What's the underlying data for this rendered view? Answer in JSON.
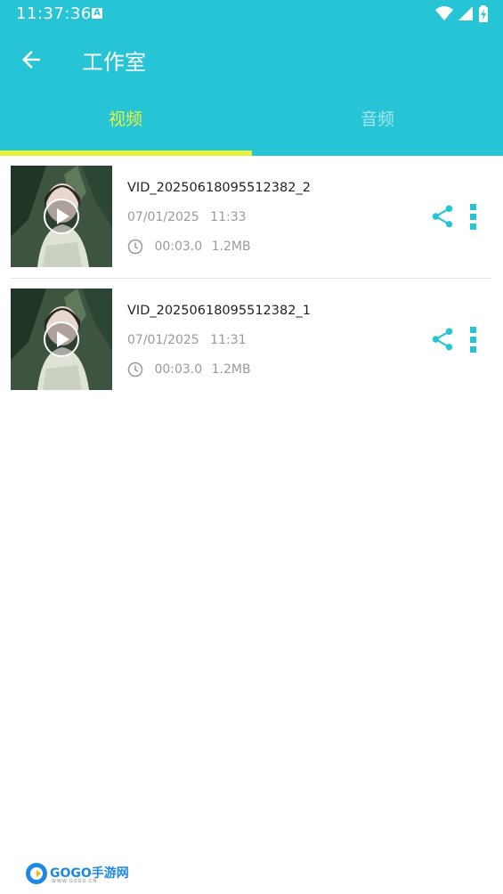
{
  "status_bar": {
    "time": "11:37:36",
    "notification_badge": "A"
  },
  "app_bar": {
    "title": "工作室"
  },
  "tabs": [
    {
      "label": "视频",
      "selected": true
    },
    {
      "label": "音频",
      "selected": false
    }
  ],
  "colors": {
    "primary": "#27c4d6",
    "accent": "#e7f53a",
    "icon": "#27c4d6"
  },
  "videos": [
    {
      "name": "VID_20250618095512382_2",
      "date": "07/01/2025",
      "time": "11:33",
      "duration": "00:03.0",
      "size": "1.2MB"
    },
    {
      "name": "VID_20250618095512382_1",
      "date": "07/01/2025",
      "time": "11:31",
      "duration": "00:03.0",
      "size": "1.2MB"
    }
  ],
  "watermark": {
    "text": "GOGO手游网",
    "sub": "WWW.GOGO.CN"
  }
}
